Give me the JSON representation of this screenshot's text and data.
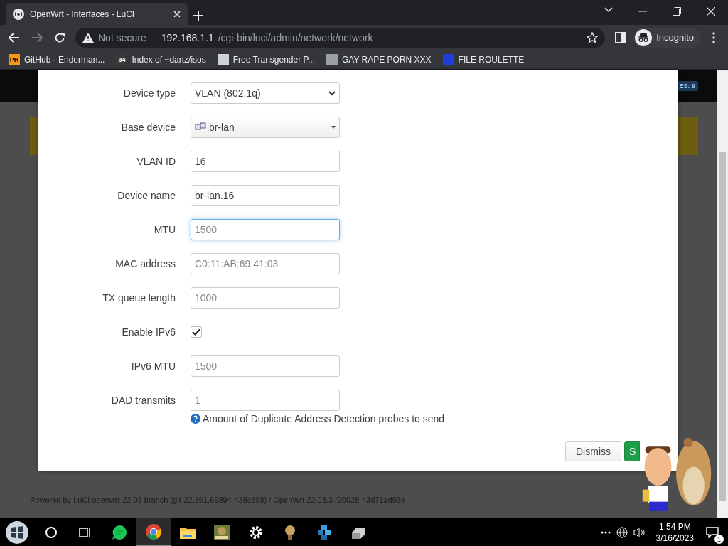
{
  "browser": {
    "tab": {
      "title": "OpenWrt - Interfaces - LuCI",
      "selected": true
    },
    "omnibox": {
      "security": "Not secure",
      "host": "192.168.1.1",
      "path": "/cgi-bin/luci/admin/network/network"
    },
    "profile": "Incognito",
    "bookmarks": [
      {
        "label": "GitHub - Enderman...",
        "icon_text": "PH",
        "color": "#f7971d"
      },
      {
        "label": "Index of ~dartz/isos",
        "icon_text": "34",
        "color": "#3a3a3a"
      },
      {
        "label": "Free Transgender P...",
        "color": "#cfd3da"
      },
      {
        "label": "GAY RAPE PORN XXX",
        "color": "#9aa0a6"
      },
      {
        "label": "FILE ROULETTE",
        "color": "#1f3fd9"
      }
    ]
  },
  "page": {
    "badge": "ES: 9",
    "footer": "Powered by LuCI openwrt-22.03 branch (git-22.361.69894-438c598) / OpenWrt 22.03.3 r20028-43d71ad93e"
  },
  "dialog": {
    "fields": [
      {
        "kind": "select",
        "label": "Device type",
        "value": "VLAN (802.1q)"
      },
      {
        "kind": "combo",
        "label": "Base device",
        "value": "br-lan"
      },
      {
        "kind": "input",
        "label": "VLAN ID",
        "value": "16",
        "focused": false
      },
      {
        "kind": "input",
        "label": "Device name",
        "value": "br-lan.16",
        "focused": false
      },
      {
        "kind": "input",
        "label": "MTU",
        "placeholder": "1500",
        "focused": true
      },
      {
        "kind": "input",
        "label": "MAC address",
        "placeholder": "C0:11:AB:69:41:03",
        "focused": false
      },
      {
        "kind": "input",
        "label": "TX queue length",
        "placeholder": "1000",
        "focused": false
      },
      {
        "kind": "checkbox",
        "label": "Enable IPv6",
        "checked": true
      },
      {
        "kind": "input",
        "label": "IPv6 MTU",
        "placeholder": "1500",
        "focused": false
      },
      {
        "kind": "input",
        "label": "DAD transmits",
        "placeholder": "1",
        "focused": false,
        "help": "Amount of Duplicate Address Detection probes to send"
      }
    ],
    "buttons": [
      {
        "kind": "neutral",
        "label": "Dismiss"
      },
      {
        "kind": "positive",
        "label": "S"
      }
    ]
  },
  "taskbar": {
    "apps": [
      {
        "kind": "cortana",
        "active": false
      },
      {
        "kind": "taskview",
        "active": false
      },
      {
        "kind": "chat",
        "active": false
      },
      {
        "kind": "chrome",
        "active": true
      },
      {
        "kind": "folder",
        "active": false
      },
      {
        "kind": "game",
        "active": false
      },
      {
        "kind": "gear",
        "active": false
      },
      {
        "kind": "bulb",
        "active": false
      },
      {
        "kind": "cubes",
        "active": false
      },
      {
        "kind": "drive",
        "active": false
      }
    ],
    "time": "1:54 PM",
    "date": "3/16/2023",
    "notifications": "1"
  }
}
